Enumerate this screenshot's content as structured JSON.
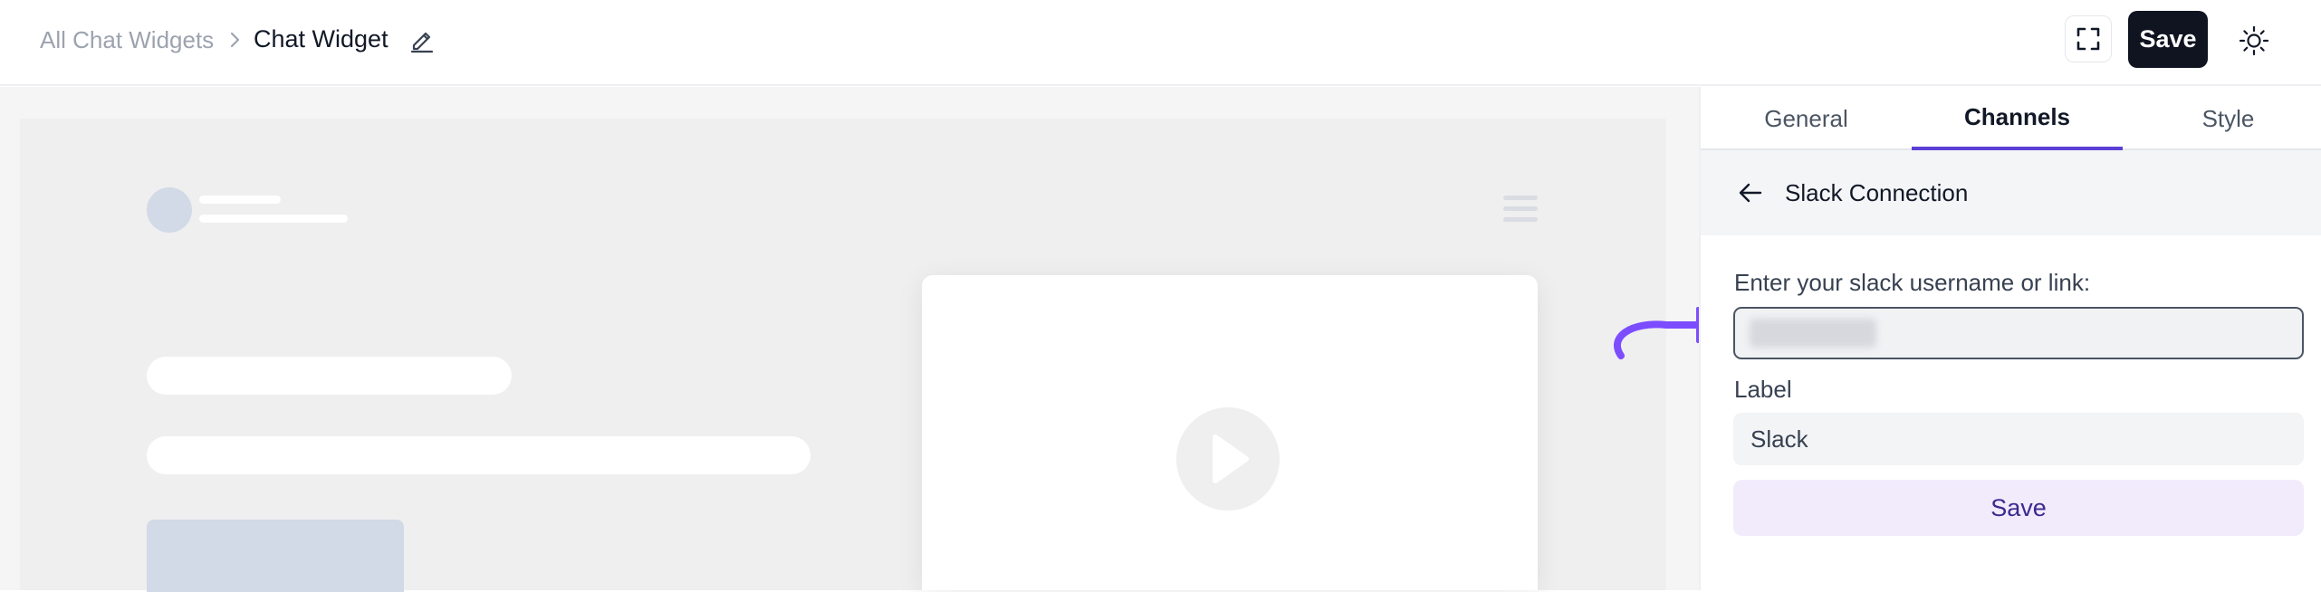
{
  "header": {
    "breadcrumb_parent": "All Chat Widgets",
    "breadcrumb_current": "Chat Widget",
    "save_label": "Save"
  },
  "tabs": [
    {
      "label": "General",
      "active": false
    },
    {
      "label": "Channels",
      "active": true
    },
    {
      "label": "Style",
      "active": false
    }
  ],
  "panel": {
    "title": "Slack Connection",
    "username_label": "Enter your slack username or link:",
    "username_value": "",
    "label_label": "Label",
    "label_value": "Slack",
    "save_label": "Save"
  },
  "colors": {
    "accent": "#5b3fd6",
    "arrow": "#7c4dff",
    "save_dark": "#0f1420",
    "save_soft_bg": "#f1ebfc"
  },
  "icons": [
    "chevron-right-icon",
    "pencil-icon",
    "fullscreen-icon",
    "sun-icon",
    "arrow-left-icon",
    "menu-icon",
    "play-icon",
    "annotation-arrow-icon"
  ]
}
